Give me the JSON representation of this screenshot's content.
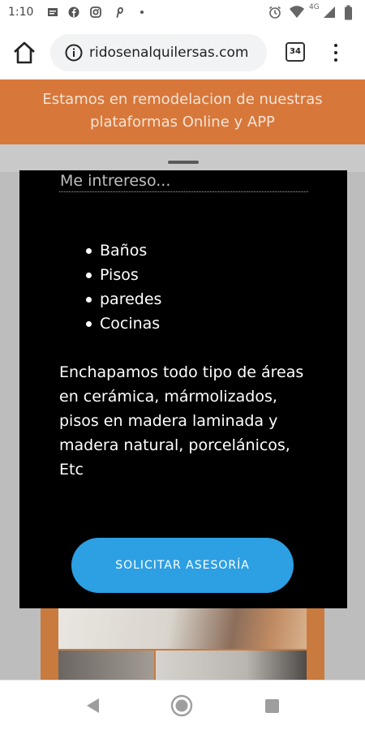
{
  "status_bar": {
    "time": "1:10",
    "network": "4G",
    "left_icons": [
      "message-icon",
      "facebook-icon",
      "instagram-icon",
      "pinterest-icon",
      "more-dot-icon"
    ],
    "right_icons": [
      "alarm-icon",
      "wifi-icon",
      "signal-icon",
      "battery-icon"
    ]
  },
  "browser": {
    "url": "ridosenalquilersas.com",
    "tab_count": "34"
  },
  "banner": {
    "line1": "Estamos en remodelacion de nuestras",
    "line2": "plataformas Online y APP",
    "bg_color": "#d8773a"
  },
  "modal": {
    "heading": "Me intrereso...",
    "services": [
      "Baños",
      "Pisos",
      "paredes",
      "Cocinas"
    ],
    "description": "Enchapamos todo tipo de áreas en cerámica, mármolizados, pisos en madera laminada y madera natural, porcelánicos, Etc",
    "cta_label": "SOLICITAR ASESORÍA",
    "cta_color": "#2d9fe3"
  },
  "nav_bar": {
    "buttons": [
      "back-icon",
      "home-icon",
      "recents-icon"
    ]
  }
}
